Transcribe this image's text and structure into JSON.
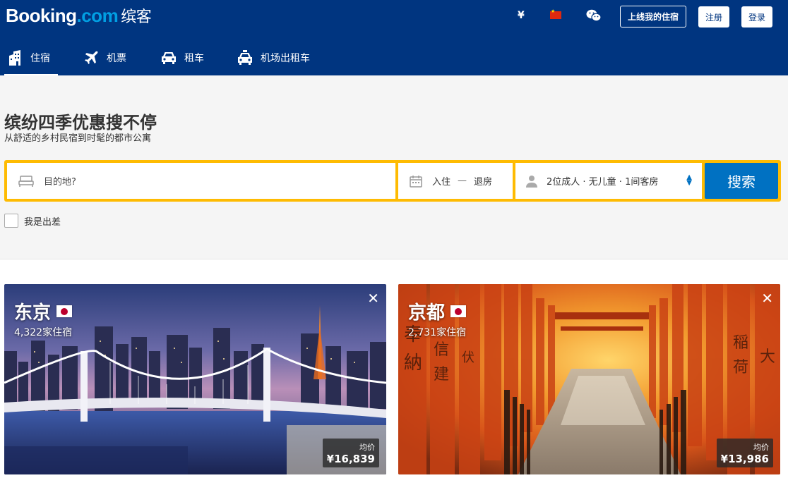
{
  "header": {
    "logo_main": "Booking",
    "logo_dotcom": ".com",
    "logo_cn": "缤客",
    "currency": "¥",
    "list_property": "上线我的住宿",
    "register": "注册",
    "login": "登录"
  },
  "nav": {
    "items": [
      {
        "label": "住宿",
        "icon": "hotel-icon",
        "active": true
      },
      {
        "label": "机票",
        "icon": "plane-icon"
      },
      {
        "label": "租车",
        "icon": "car-icon"
      },
      {
        "label": "机场出租车",
        "icon": "taxi-icon"
      }
    ]
  },
  "hero": {
    "title": "缤纷四季优惠搜不停",
    "subtitle": "从舒适的乡村民宿到时髦的都市公寓"
  },
  "search": {
    "destination_placeholder": "目的地?",
    "checkin": "入住",
    "dash": "—",
    "checkout": "退房",
    "guests": "2位成人 · 无儿童 · 1间客房",
    "search_button": "搜索",
    "business_trip": "我是出差"
  },
  "cards": [
    {
      "city": "东京",
      "count": "4,322家住宿",
      "price_label": "均价",
      "price": "¥16,839"
    },
    {
      "city": "京都",
      "count": "2,731家住宿",
      "price_label": "均价",
      "price": "¥13,986"
    }
  ],
  "colors": {
    "brand_blue": "#003580",
    "search_yellow": "#febb02",
    "button_blue": "#0071c2"
  }
}
